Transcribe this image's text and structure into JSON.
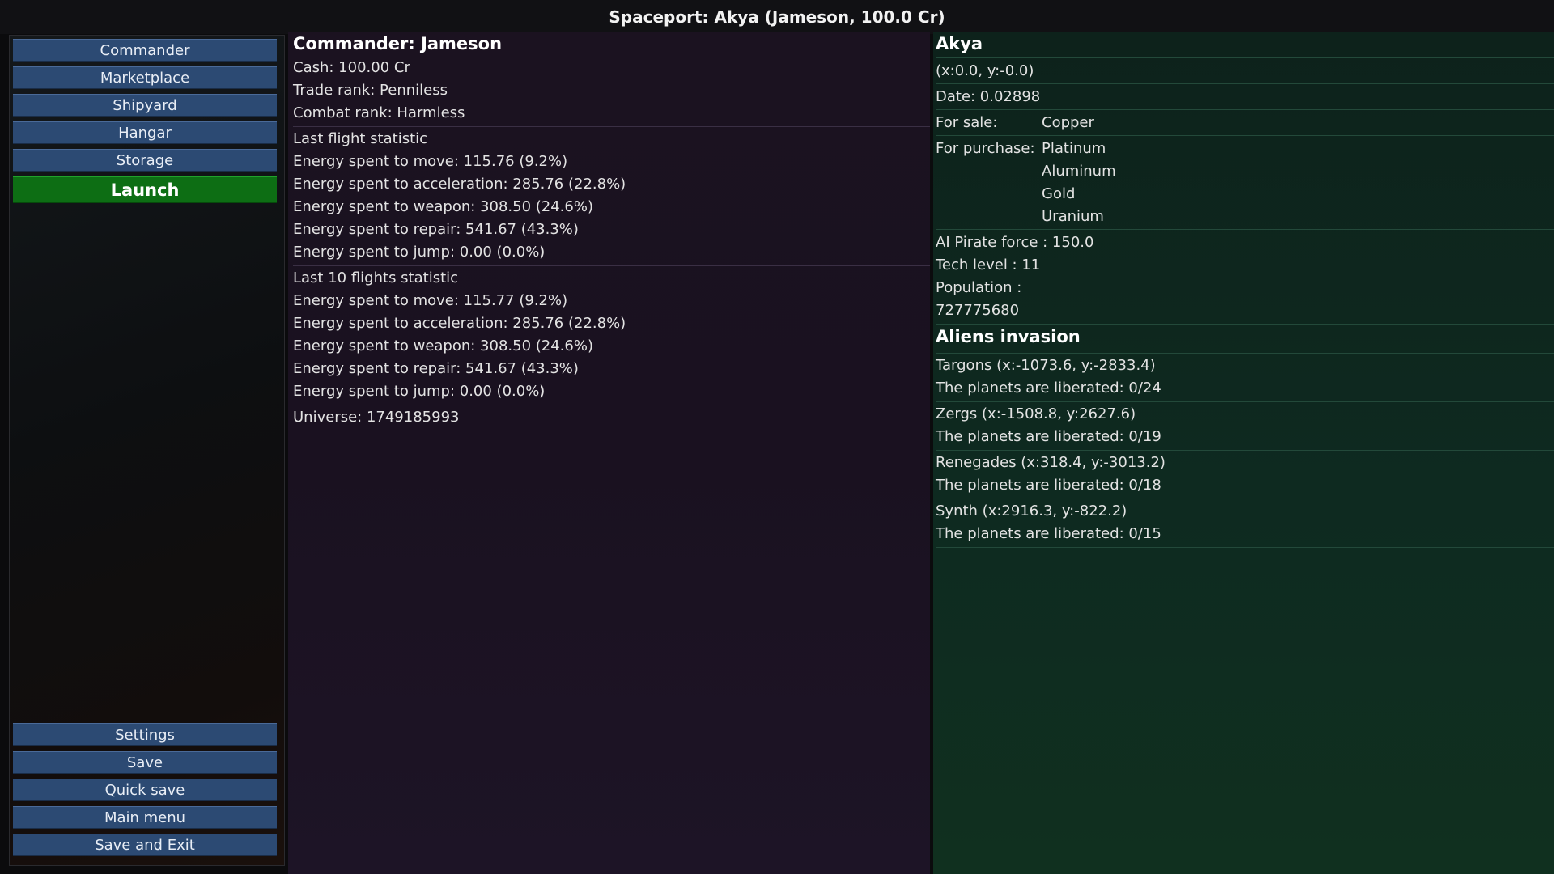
{
  "header": {
    "title": "Spaceport: Akya (Jameson, 100.0 Cr)"
  },
  "menu": {
    "top": [
      "Commander",
      "Marketplace",
      "Shipyard",
      "Hangar",
      "Storage"
    ],
    "launch": "Launch",
    "bottom": [
      "Settings",
      "Save",
      "Quick save",
      "Main menu",
      "Save and Exit"
    ]
  },
  "commander": {
    "title": "Commander: Jameson",
    "cash": "Cash: 100.00 Cr",
    "trade_rank": "Trade rank: Penniless",
    "combat_rank": "Combat rank: Harmless",
    "last_flight": {
      "heading": "Last flight statistic",
      "lines": [
        "Energy spent to move: 115.76 (9.2%)",
        "Energy spent to acceleration: 285.76 (22.8%)",
        "Energy spent to weapon: 308.50 (24.6%)",
        "Energy spent to repair: 541.67 (43.3%)",
        "Energy spent to jump: 0.00 (0.0%)"
      ]
    },
    "last_10": {
      "heading": "Last 10 flights statistic",
      "lines": [
        "Energy spent to move: 115.77 (9.2%)",
        "Energy spent to acceleration: 285.76 (22.8%)",
        "Energy spent to weapon: 308.50 (24.6%)",
        "Energy spent to repair: 541.67 (43.3%)",
        "Energy spent to jump: 0.00 (0.0%)"
      ]
    },
    "universe": "Universe: 1749185993"
  },
  "planet": {
    "name": "Akya",
    "coords": "(x:0.0, y:-0.0)",
    "date": "Date: 0.02898",
    "for_sale_label": "For sale:",
    "for_sale": [
      "Copper"
    ],
    "for_purchase_label": "For purchase:",
    "for_purchase": [
      "Platinum",
      "Aluminum",
      "Gold",
      "Uranium"
    ],
    "pirate_force": "AI Pirate force : 150.0",
    "tech_level": "Tech level : 11",
    "population_label": "Population :",
    "population": "727775680"
  },
  "aliens": {
    "heading": "Aliens invasion",
    "groups": [
      {
        "name": "Targons (x:-1073.6, y:-2833.4)",
        "status": "The planets are liberated: 0/24"
      },
      {
        "name": "Zergs (x:-1508.8, y:2627.6)",
        "status": "The planets are liberated: 0/19"
      },
      {
        "name": "Renegades (x:318.4, y:-3013.2)",
        "status": "The planets are liberated: 0/18"
      },
      {
        "name": "Synth (x:2916.3, y:-822.2)",
        "status": "The planets are liberated: 0/15"
      }
    ]
  },
  "colors": {
    "button": "#2c4a73",
    "launch": "#0d6e14",
    "mid_panel": "#1b1220",
    "right_panel": "#0e2a20"
  }
}
